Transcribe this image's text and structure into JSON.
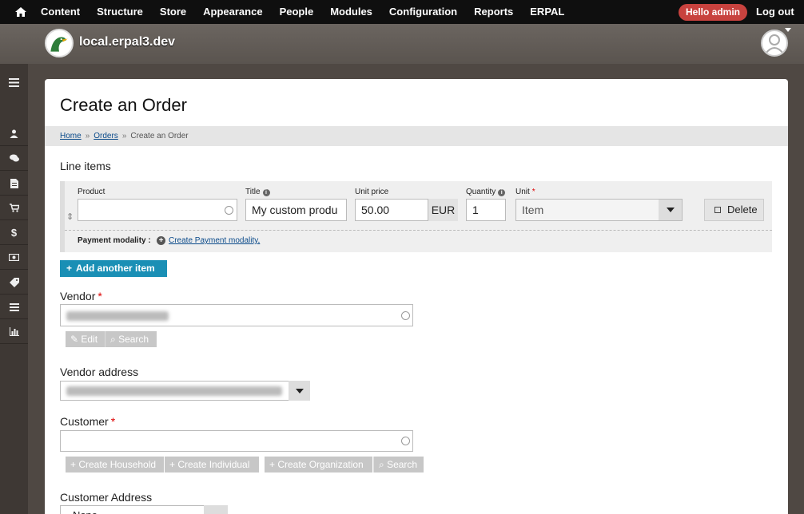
{
  "toolbar": {
    "menu": [
      "Content",
      "Structure",
      "Store",
      "Appearance",
      "People",
      "Modules",
      "Configuration",
      "Reports",
      "ERPAL"
    ],
    "hello": "Hello admin",
    "logout": "Log out"
  },
  "site": {
    "name": "local.erpal3.dev"
  },
  "page": {
    "title": "Create an Order",
    "breadcrumb": {
      "home": "Home",
      "orders": "Orders",
      "current": "Create an Order",
      "separator": "»"
    }
  },
  "line_items": {
    "section_label": "Line items",
    "labels": {
      "product": "Product",
      "title": "Title",
      "unit_price": "Unit price",
      "quantity": "Quantity",
      "unit": "Unit"
    },
    "values": {
      "product": "",
      "title": "My custom produ",
      "unit_price": "50.00",
      "currency": "EUR",
      "quantity": "1",
      "unit": "Item"
    },
    "delete_label": "Delete",
    "payment_modality_label": "Payment modality :",
    "payment_modality_link": "Create Payment modality",
    "payment_modality_suffix": ","
  },
  "add_item_label": "Add another item",
  "vendor": {
    "label": "Vendor",
    "edit_label": "Edit",
    "search_label": "Search"
  },
  "vendor_address": {
    "label": "Vendor address"
  },
  "customer": {
    "label": "Customer",
    "value": "",
    "buttons": [
      "Create Household",
      "Create Individual",
      "Create Organization",
      "Search"
    ]
  },
  "customer_address": {
    "label": "Customer Address",
    "value": "- None -"
  },
  "colors": {
    "toolbar": "#0f0f0f",
    "accent": "#1a8fb5",
    "hello_badge": "#c8423e",
    "sitebar": "#5f5954"
  }
}
